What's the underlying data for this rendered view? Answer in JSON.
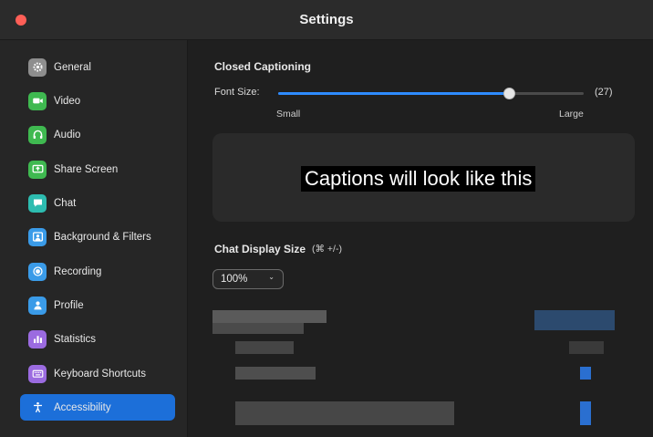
{
  "window": {
    "title": "Settings"
  },
  "sidebar": {
    "items": [
      {
        "label": "General",
        "icon": "gear-icon",
        "color": "#8e8e8e"
      },
      {
        "label": "Video",
        "icon": "video-camera-icon",
        "color": "#3fb950"
      },
      {
        "label": "Audio",
        "icon": "headphones-icon",
        "color": "#3fb950"
      },
      {
        "label": "Share Screen",
        "icon": "share-screen-icon",
        "color": "#3fb950"
      },
      {
        "label": "Chat",
        "icon": "chat-bubble-icon",
        "color": "#2dbcb0"
      },
      {
        "label": "Background & Filters",
        "icon": "person-portrait-icon",
        "color": "#3a9be8"
      },
      {
        "label": "Recording",
        "icon": "record-icon",
        "color": "#3a9be8"
      },
      {
        "label": "Profile",
        "icon": "person-icon",
        "color": "#3a9be8"
      },
      {
        "label": "Statistics",
        "icon": "bar-chart-icon",
        "color": "#9b6be0"
      },
      {
        "label": "Keyboard Shortcuts",
        "icon": "keyboard-icon",
        "color": "#9b6be0"
      },
      {
        "label": "Accessibility",
        "icon": "accessibility-icon",
        "color": "#1c6fd9",
        "active": true
      }
    ]
  },
  "closed_captioning": {
    "title": "Closed Captioning",
    "font_size_label": "Font Size:",
    "value_text": "(27)",
    "level_fraction": 0.755,
    "min_label": "Small",
    "max_label": "Large",
    "preview_text": "Captions will look like this"
  },
  "chat_display": {
    "title": "Chat Display Size",
    "shortcut": "(⌘ +/-)",
    "selected": "100%"
  },
  "colors": {
    "accent": "#1c6fd9",
    "slider": "#2e8bff"
  }
}
